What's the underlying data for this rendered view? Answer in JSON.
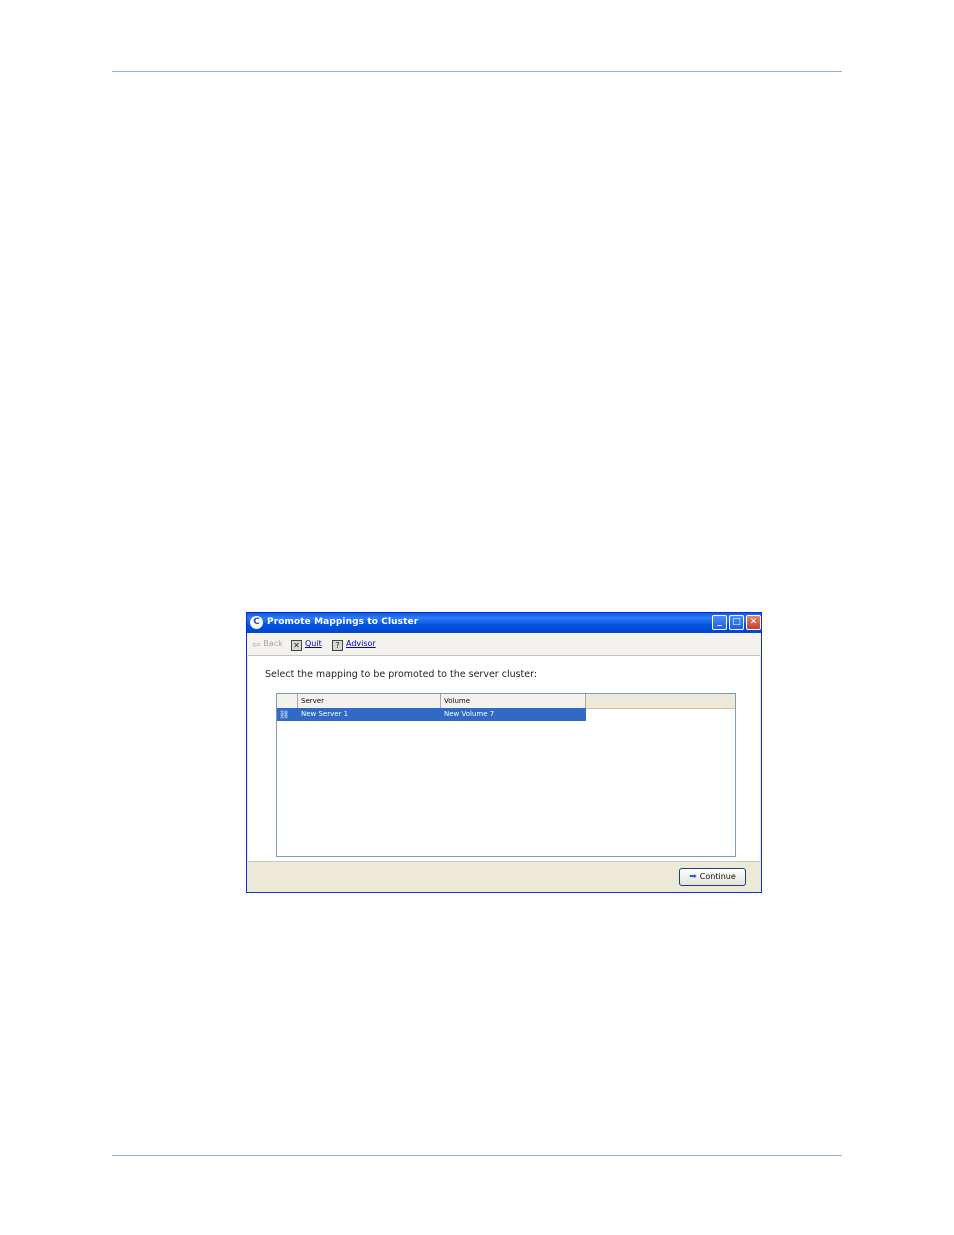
{
  "window": {
    "title": "Promote Mappings to Cluster",
    "app_icon": "C",
    "controls": {
      "minimize": "_",
      "maximize": "□",
      "close": "✕"
    }
  },
  "toolbar": {
    "back_label": "Back",
    "quit_label": "Quit",
    "advisor_label": "Advisor",
    "back_icon": "arrow-left-icon",
    "quit_icon": "quit-icon",
    "advisor_icon": "help-icon"
  },
  "main": {
    "prompt": "Select the mapping to be promoted to the server cluster:",
    "table": {
      "columns": [
        "",
        "Server",
        "Volume"
      ],
      "rows": [
        {
          "icon": "mapping-icon",
          "server": "New Server 1",
          "volume": "New Volume 7",
          "selected": true
        }
      ]
    }
  },
  "footer": {
    "continue_label": "Continue"
  },
  "colors": {
    "title_bar": "#0054e3",
    "selection": "#316ac5",
    "link": "#0000cc",
    "page_rule": "#8fb3c9"
  }
}
